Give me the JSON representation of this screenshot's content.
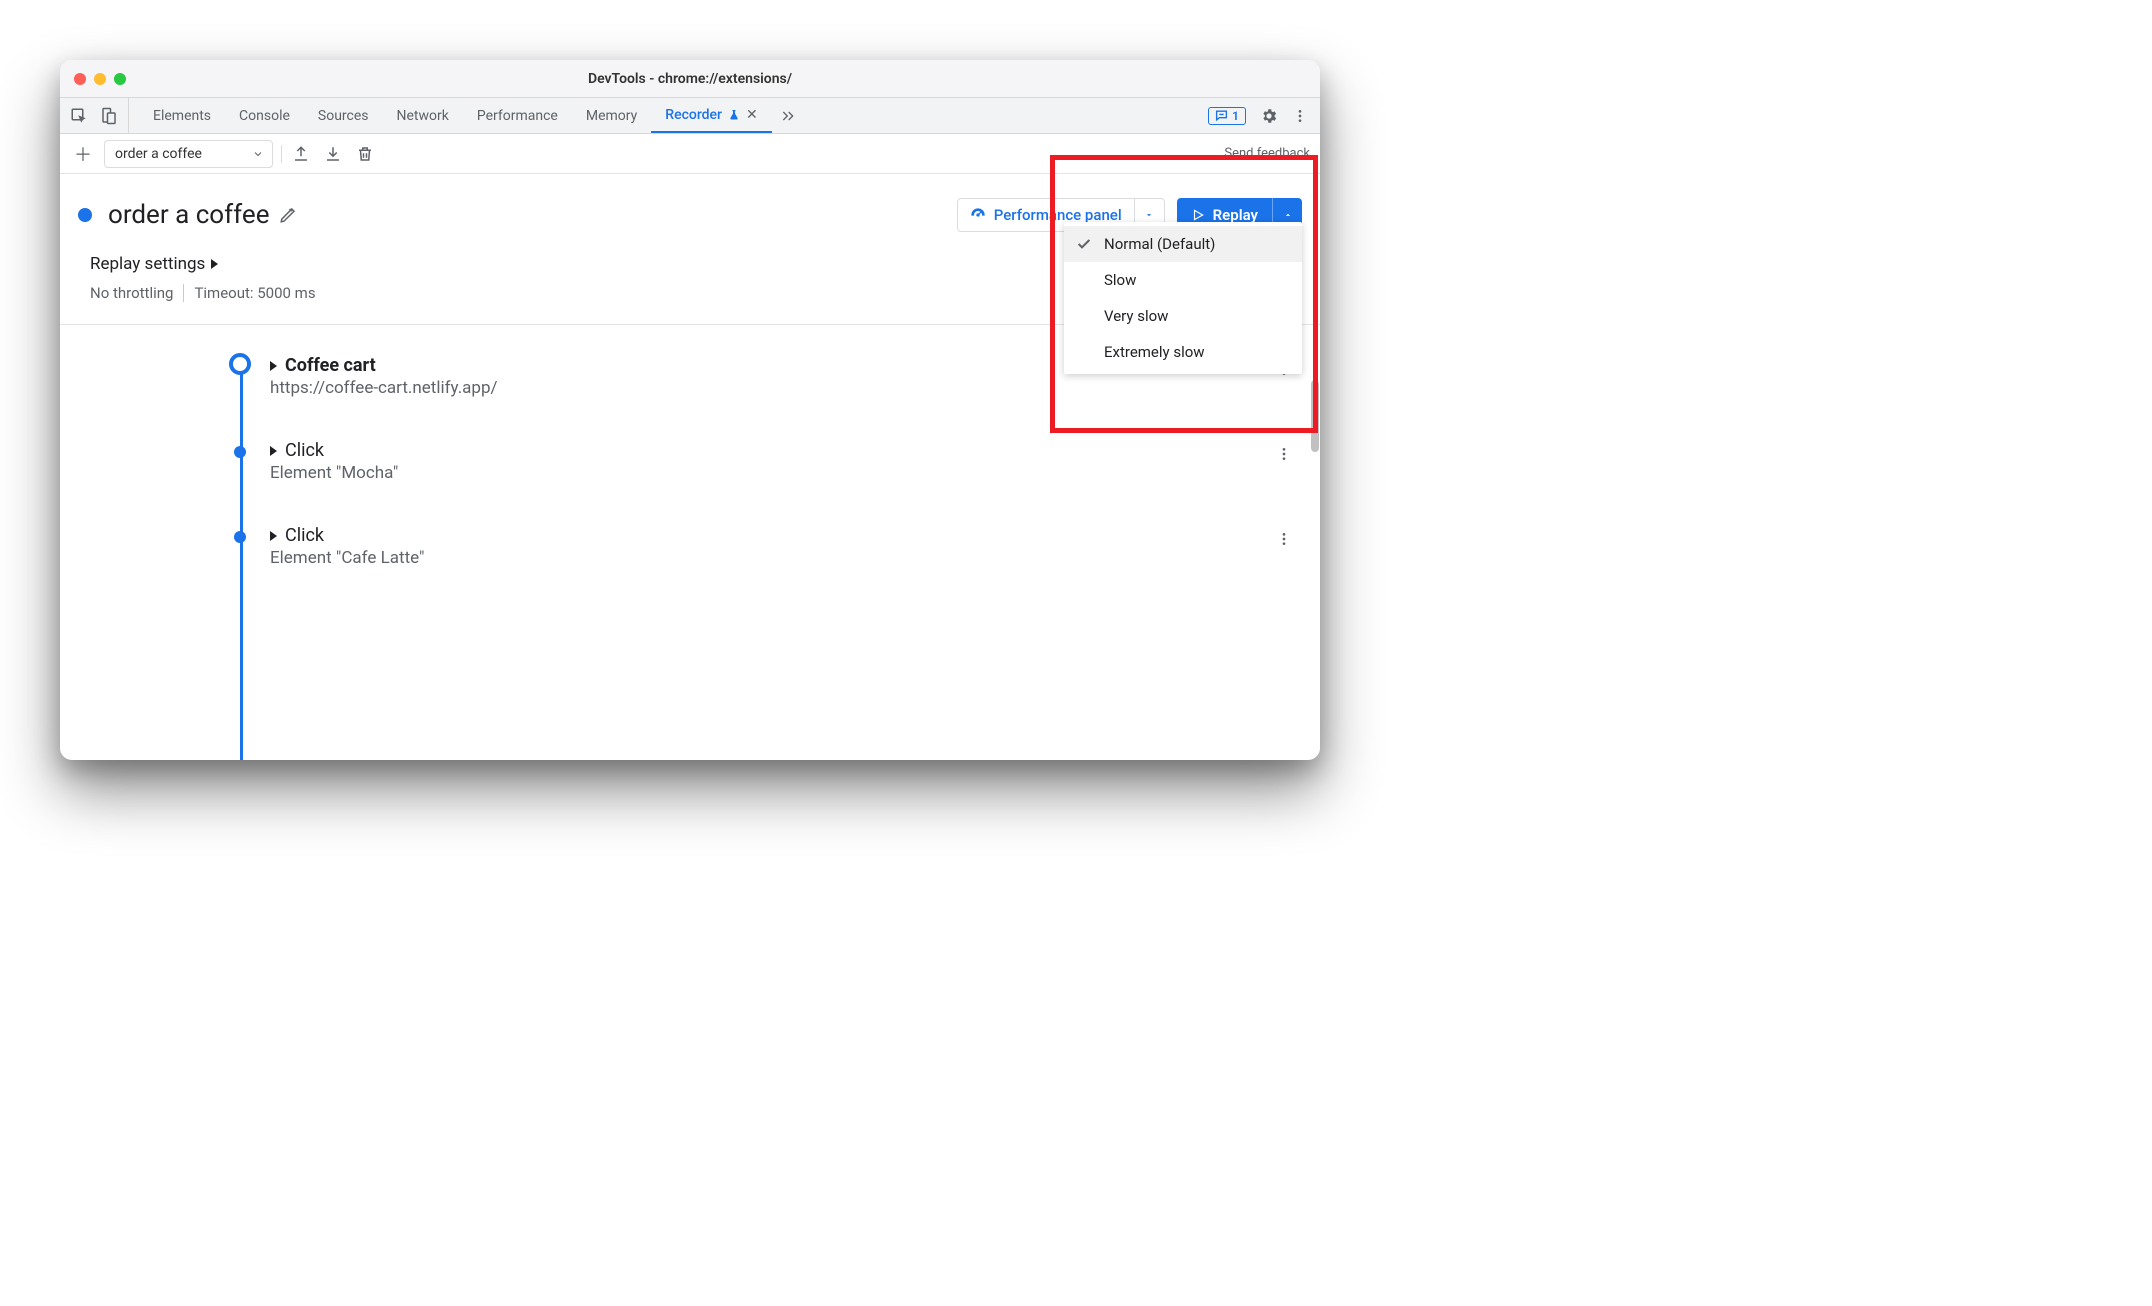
{
  "window": {
    "title": "DevTools - chrome://extensions/"
  },
  "tabs": {
    "items": [
      "Elements",
      "Console",
      "Sources",
      "Network",
      "Performance",
      "Memory",
      "Recorder"
    ],
    "active_index": 6,
    "feedback_count": "1"
  },
  "toolbar": {
    "recording_name": "order a coffee",
    "send_feedback": "Send feedback"
  },
  "header": {
    "title": "order a coffee",
    "perf_panel_label": "Performance panel",
    "replay_label": "Replay"
  },
  "settings": {
    "heading": "Replay settings",
    "throttling": "No throttling",
    "timeout": "Timeout: 5000 ms"
  },
  "steps": [
    {
      "title": "Coffee cart",
      "sub": "https://coffee-cart.netlify.app/"
    },
    {
      "title": "Click",
      "sub": "Element \"Mocha\""
    },
    {
      "title": "Click",
      "sub": "Element \"Cafe Latte\""
    }
  ],
  "dropdown": {
    "items": [
      "Normal (Default)",
      "Slow",
      "Very slow",
      "Extremely slow"
    ],
    "selected_index": 0
  }
}
